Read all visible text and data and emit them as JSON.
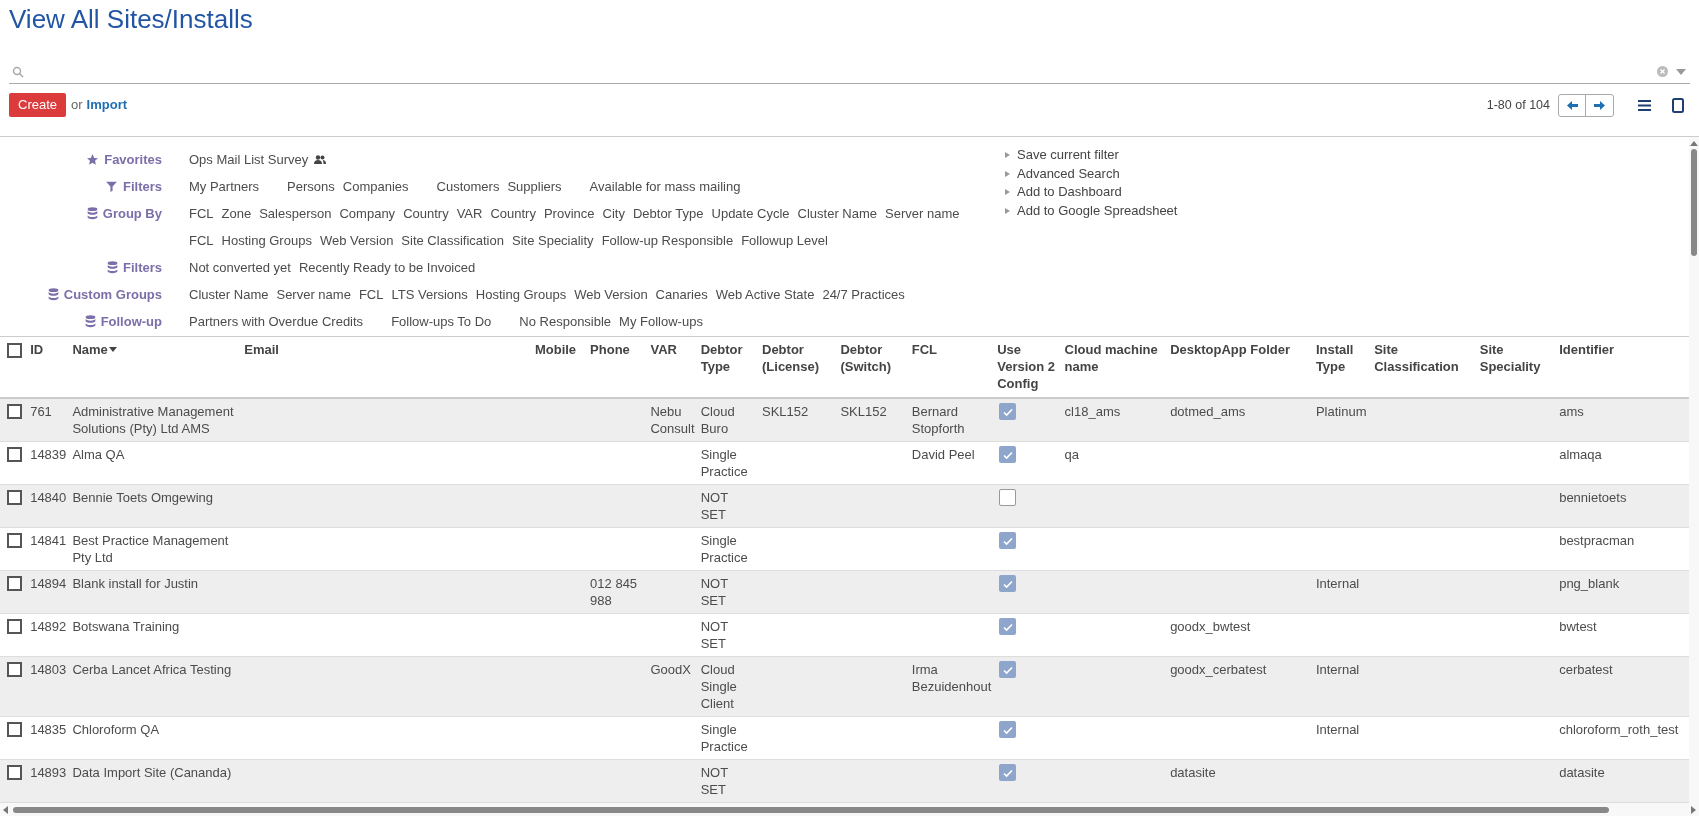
{
  "title": "View All Sites/Installs",
  "toolbar": {
    "create": "Create",
    "or": "or",
    "import": "Import",
    "pager": "1-80 of 104"
  },
  "filter_sections": [
    {
      "label": "Favorites",
      "groups": [
        {
          "items": [
            "Ops Mail List Survey"
          ],
          "shared": true
        }
      ]
    },
    {
      "label": "Filters",
      "groups": [
        {
          "items": [
            "My Partners"
          ]
        },
        {
          "items": [
            "Persons",
            "Companies"
          ]
        },
        {
          "items": [
            "Customers",
            "Suppliers"
          ]
        },
        {
          "items": [
            "Available for mass mailing"
          ]
        }
      ]
    },
    {
      "label": "Group By",
      "groups": [
        {
          "items": [
            "FCL",
            "Zone",
            "Salesperson",
            "Company",
            "Country",
            "VAR",
            "Country",
            "Province",
            "City",
            "Debtor Type",
            "Update Cycle",
            "Cluster Name",
            "Server name",
            "FCL",
            "Hosting Groups",
            "Web Version",
            "Site Classification",
            "Site Speciality",
            "Follow-up Responsible",
            "Followup Level"
          ]
        }
      ]
    },
    {
      "label": "Filters",
      "groups": [
        {
          "items": [
            "Not converted yet",
            "Recently Ready to be Invoiced"
          ]
        }
      ]
    },
    {
      "label": "Custom Groups",
      "groups": [
        {
          "items": [
            "Cluster Name",
            "Server name",
            "FCL",
            "LTS Versions",
            "Hosting Groups",
            "Web Version",
            "Canaries",
            "Web Active State",
            "24/7 Practices"
          ]
        }
      ]
    },
    {
      "label": "Follow-up",
      "groups": [
        {
          "items": [
            "Partners with Overdue Credits"
          ]
        },
        {
          "items": [
            "Follow-ups To Do"
          ]
        },
        {
          "items": [
            "No Responsible",
            "My Follow-ups"
          ]
        }
      ]
    }
  ],
  "filter_actions": [
    "Save current filter",
    "Advanced Search",
    "Add to Dashboard",
    "Add to Google Spreadsheet"
  ],
  "table": {
    "all_selected": false,
    "columns": [
      {
        "label": "ID",
        "kind": "text"
      },
      {
        "label": "Name",
        "kind": "text",
        "sorted": true
      },
      {
        "label": "Email",
        "kind": "text"
      },
      {
        "label": "Mobile",
        "kind": "text"
      },
      {
        "label": "Phone",
        "kind": "text"
      },
      {
        "label": "VAR",
        "kind": "text"
      },
      {
        "label": "Debtor Type",
        "kind": "text"
      },
      {
        "label": "Debtor (License)",
        "kind": "text"
      },
      {
        "label": "Debtor (Switch)",
        "kind": "text"
      },
      {
        "label": "FCL",
        "kind": "text"
      },
      {
        "label": "Use Version 2 Config",
        "kind": "checkbox"
      },
      {
        "label": "Cloud machine name",
        "kind": "text"
      },
      {
        "label": "DesktopApp Folder",
        "kind": "text"
      },
      {
        "label": "Install Type",
        "kind": "text"
      },
      {
        "label": "Site Classification",
        "kind": "text"
      },
      {
        "label": "Site Speciality",
        "kind": "text"
      },
      {
        "label": "Identifier",
        "kind": "text"
      }
    ],
    "rows": [
      {
        "selected": false,
        "cells": [
          "761",
          "Administrative Management Solutions (Pty) Ltd AMS",
          null,
          null,
          null,
          "Nebu Consult",
          "Cloud Buro",
          "SKL152",
          "SKL152",
          "Bernard Stopforth",
          true,
          "cl18_ams",
          "dotmed_ams",
          "Platinum",
          null,
          null,
          "ams"
        ]
      },
      {
        "selected": false,
        "cells": [
          "14839",
          "Alma QA",
          null,
          null,
          null,
          null,
          "Single Practice",
          null,
          null,
          "David Peel",
          true,
          "qa",
          null,
          null,
          null,
          null,
          "almaqa"
        ]
      },
      {
        "selected": false,
        "cells": [
          "14840",
          "Bennie Toets Omgewing",
          null,
          null,
          null,
          null,
          "NOT SET",
          null,
          null,
          null,
          false,
          null,
          null,
          null,
          null,
          null,
          "bennietoets"
        ]
      },
      {
        "selected": false,
        "cells": [
          "14841",
          "Best Practice Management Pty Ltd",
          null,
          null,
          null,
          null,
          "Single Practice",
          null,
          null,
          null,
          true,
          null,
          null,
          null,
          null,
          null,
          "bestpracman"
        ]
      },
      {
        "selected": false,
        "cells": [
          "14894",
          "Blank install for Justin",
          null,
          null,
          "012 845 988",
          null,
          "NOT SET",
          null,
          null,
          null,
          true,
          null,
          null,
          "Internal",
          null,
          null,
          "png_blank"
        ]
      },
      {
        "selected": false,
        "cells": [
          "14892",
          "Botswana Training",
          null,
          null,
          null,
          null,
          "NOT SET",
          null,
          null,
          null,
          true,
          null,
          "goodx_bwtest",
          null,
          null,
          null,
          "bwtest"
        ]
      },
      {
        "selected": false,
        "cells": [
          "14803",
          "Cerba Lancet Africa Testing",
          null,
          null,
          null,
          "GoodX",
          "Cloud Single Client",
          null,
          null,
          "Irma Bezuidenhout",
          true,
          null,
          "goodx_cerbatest",
          "Internal",
          null,
          null,
          "cerbatest"
        ]
      },
      {
        "selected": false,
        "cells": [
          "14835",
          "Chloroform QA",
          null,
          null,
          null,
          null,
          "Single Practice",
          null,
          null,
          null,
          true,
          null,
          null,
          "Internal",
          null,
          null,
          "chloroform_roth_test"
        ]
      },
      {
        "selected": false,
        "cells": [
          "14893",
          "Data Import Site (Cananda)",
          null,
          null,
          null,
          null,
          "NOT SET",
          null,
          null,
          null,
          true,
          null,
          "datasite",
          null,
          null,
          null,
          "datasite"
        ]
      }
    ]
  }
}
